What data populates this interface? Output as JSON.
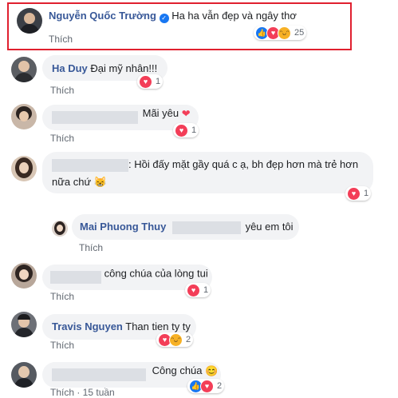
{
  "highlight_color": "#e0202f",
  "like_label": "Thích",
  "comments": [
    {
      "name": "Nguyễn Quốc Trường",
      "verified": true,
      "text": "Ha ha vẫn đẹp và ngây thơ",
      "reactions": [
        "like-icon",
        "heart-icon",
        "haha-icon"
      ],
      "count": "25"
    },
    {
      "name": "Ha Duy",
      "text": "Đại mỹ nhân!!!",
      "reactions": [
        "heart-icon"
      ],
      "count": "1"
    },
    {
      "text": "Mãi yêu",
      "emoji": "❤",
      "reactions": [
        "heart-icon"
      ],
      "count": "1"
    },
    {
      "text_line1": ": Hồi đấy mặt gầy quá c ạ, bh đẹp hơn mà trẻ hơn",
      "text_line2": "nữa chứ",
      "emoji": "😸",
      "reactions": [
        "heart-icon"
      ],
      "count": "1"
    },
    {
      "name": "Mai Phuong Thuy",
      "text": "yêu em tôi",
      "reply": true
    },
    {
      "text": "công chúa của lòng tui",
      "reactions": [
        "heart-icon"
      ],
      "count": "1"
    },
    {
      "name": "Travis Nguyen",
      "text": "Than tien ty ty",
      "reactions": [
        "heart-icon",
        "haha-icon"
      ],
      "count": "2"
    },
    {
      "text": "Công chúa",
      "emoji": "😊",
      "reactions": [
        "like-icon",
        "heart-icon"
      ],
      "count": "2",
      "partial": "Thích · 15 tuần"
    }
  ]
}
